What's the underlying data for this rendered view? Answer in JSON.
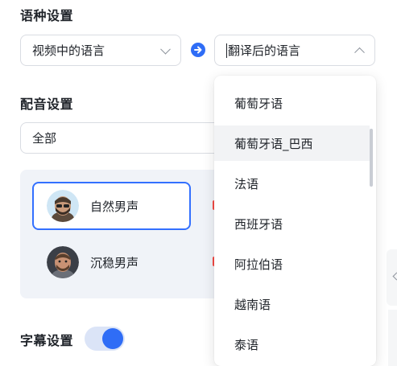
{
  "language_settings": {
    "title": "语种设置",
    "source_language_placeholder": "视频中的语言",
    "target_language_placeholder": "翻译后的语言"
  },
  "dubbing_settings": {
    "title": "配音设置",
    "filter_value": "全部",
    "voices": [
      {
        "name": "自然男声",
        "selected": true
      },
      {
        "name": "沉稳男声",
        "selected": false
      }
    ]
  },
  "subtitle_settings": {
    "title": "字幕设置",
    "enabled": true
  },
  "language_dropdown": {
    "options": [
      "葡萄牙语",
      "葡萄牙语_巴西",
      "法语",
      "西班牙语",
      "阿拉伯语",
      "越南语",
      "泰语"
    ],
    "hovered_index": 1
  },
  "colors": {
    "accent": "#3370ff",
    "toggle_on": "#2f6df6",
    "panel_bg": "#f0f3f8"
  }
}
